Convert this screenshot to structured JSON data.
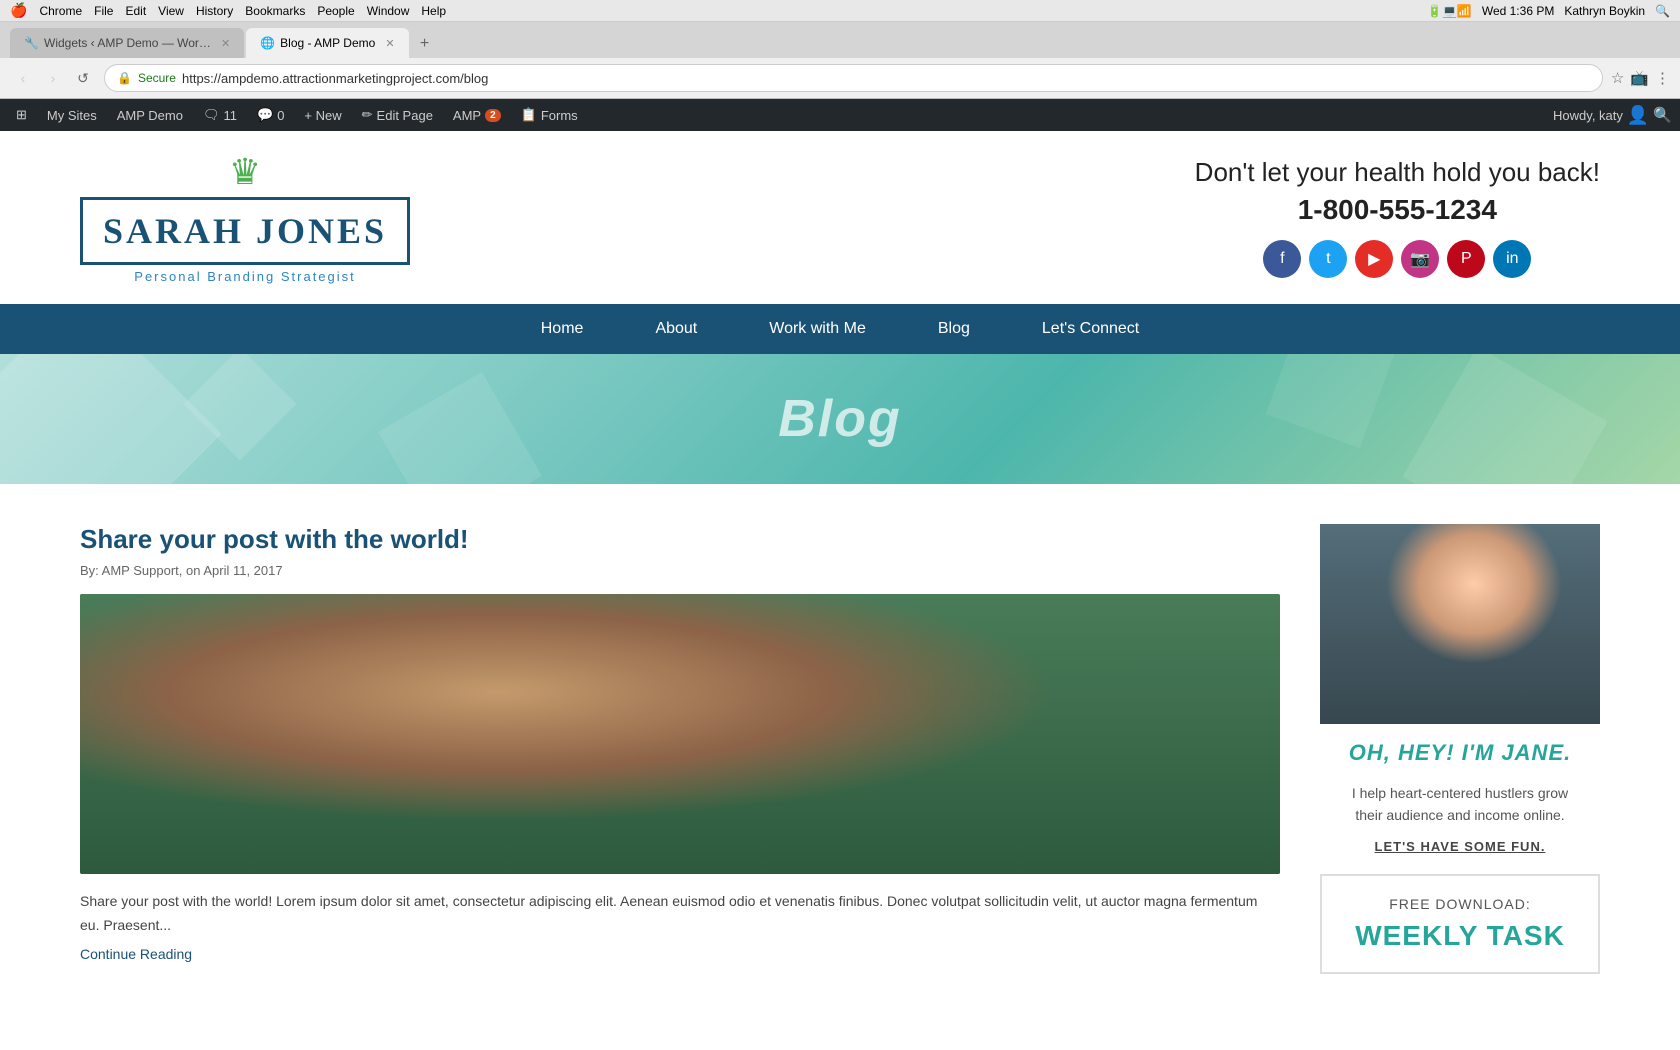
{
  "macos": {
    "apple": "🍎",
    "menu_items": [
      "Chrome",
      "File",
      "Edit",
      "View",
      "History",
      "Bookmarks",
      "People",
      "Window",
      "Help"
    ],
    "time": "Wed 1:36 PM",
    "user": "Kathryn Boykin"
  },
  "browser": {
    "tabs": [
      {
        "id": "tab1",
        "label": "Widgets ‹ AMP Demo — Wor…",
        "active": false,
        "favicon": "🔧"
      },
      {
        "id": "tab2",
        "label": "Blog - AMP Demo",
        "active": true,
        "favicon": "🌐"
      }
    ],
    "address": {
      "secure_label": "Secure",
      "url": "https://ampdemo.attractionmarketingproject.com/blog"
    }
  },
  "wp_admin": {
    "items": [
      {
        "id": "wp-logo",
        "label": "⊞",
        "badge": null
      },
      {
        "id": "my-sites",
        "label": "My Sites",
        "badge": null
      },
      {
        "id": "amp-demo",
        "label": "AMP Demo",
        "badge": null
      },
      {
        "id": "comments",
        "label": "🗨 11",
        "badge": null
      },
      {
        "id": "comments-icon",
        "label": "💬 0",
        "badge": null
      },
      {
        "id": "new",
        "label": "+ New",
        "badge": null
      },
      {
        "id": "edit-page",
        "label": "✏ Edit Page",
        "badge": null
      },
      {
        "id": "amp",
        "label": "AMP",
        "badge": "2"
      },
      {
        "id": "forms",
        "label": "📋 Forms",
        "badge": null
      }
    ],
    "howdy": "Howdy, katy"
  },
  "site": {
    "logo": {
      "crown": "♛",
      "name": "SARAH JONES",
      "tagline": "Personal Branding Strategist"
    },
    "header_right": {
      "tagline": "Don't let your health hold you back!",
      "phone": "1-800-555-1234"
    },
    "social": [
      {
        "id": "facebook",
        "class": "si-fb",
        "icon": "f"
      },
      {
        "id": "twitter",
        "class": "si-tw",
        "icon": "t"
      },
      {
        "id": "youtube",
        "class": "si-yt",
        "icon": "▶"
      },
      {
        "id": "instagram",
        "class": "si-ig",
        "icon": "📷"
      },
      {
        "id": "pinterest",
        "class": "si-pt",
        "icon": "P"
      },
      {
        "id": "linkedin",
        "class": "si-li",
        "icon": "in"
      }
    ],
    "nav": [
      {
        "id": "home",
        "label": "Home"
      },
      {
        "id": "about",
        "label": "About"
      },
      {
        "id": "work-with-me",
        "label": "Work with Me"
      },
      {
        "id": "blog",
        "label": "Blog"
      },
      {
        "id": "lets-connect",
        "label": "Let's Connect"
      }
    ]
  },
  "blog_hero": {
    "title": "Blog"
  },
  "post": {
    "title": "Share your post with the world!",
    "meta": "By: AMP Support, on April 11, 2017",
    "excerpt": "Share your post with the world! Lorem ipsum dolor sit amet, consectetur adipiscing elit. Aenean euismod odio et venenatis finibus. Donec volutpat sollicitudin velit, ut auctor magna fermentum eu. Praesent...",
    "continue_reading": "Continue Reading"
  },
  "sidebar": {
    "oh_hey": "OH, HEY! I'M JANE.",
    "desc": "I help heart-centered hustlers grow their audience and income online.",
    "cta": "LET'S HAVE SOME FUN.",
    "free_download": {
      "label": "FREE DOWNLOAD:",
      "title": "WEEKLY TASK"
    }
  }
}
